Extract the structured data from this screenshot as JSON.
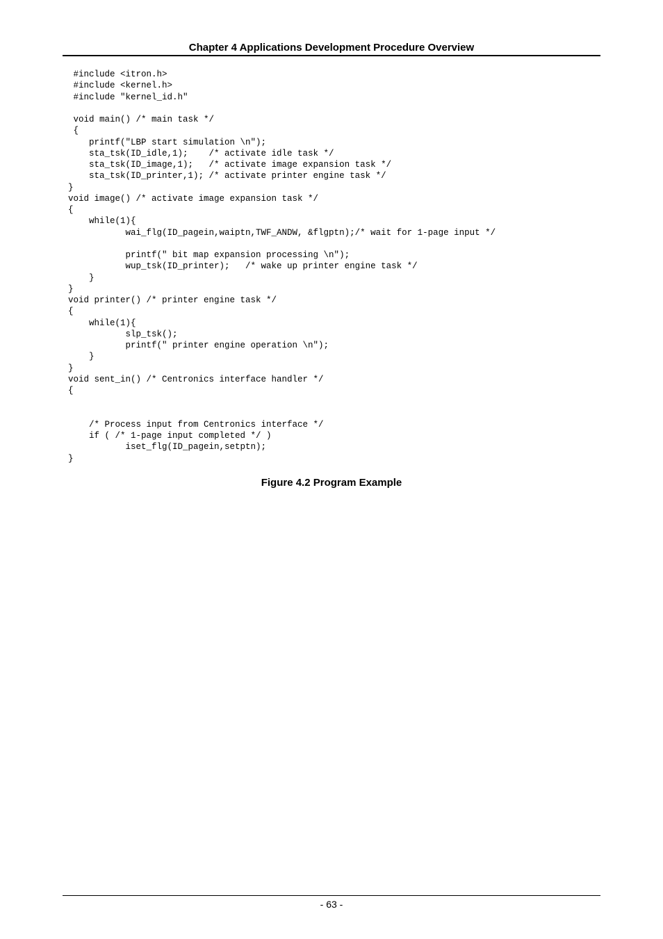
{
  "header": "Chapter 4 Applications Development Procedure Overview",
  "code": " #include <itron.h>\n #include <kernel.h>\n #include \"kernel_id.h\"\n\n void main() /* main task */\n {\n    printf(\"LBP start simulation \\n\");\n    sta_tsk(ID_idle,1);    /* activate idle task */\n    sta_tsk(ID_image,1);   /* activate image expansion task */\n    sta_tsk(ID_printer,1); /* activate printer engine task */\n}\nvoid image() /* activate image expansion task */\n{\n    while(1){\n           wai_flg(ID_pagein,waiptn,TWF_ANDW, &flgptn);/* wait for 1-page input */\n\n           printf(\" bit map expansion processing \\n\");\n           wup_tsk(ID_printer);   /* wake up printer engine task */\n    }\n}\nvoid printer() /* printer engine task */\n{\n    while(1){\n           slp_tsk();\n           printf(\" printer engine operation \\n\");\n    }\n}\nvoid sent_in() /* Centronics interface handler */\n{\n\n\n    /* Process input from Centronics interface */\n    if ( /* 1-page input completed */ )\n           iset_flg(ID_pagein,setptn);\n}",
  "figure_caption": "Figure 4.2 Program Example",
  "page_number": "- 63 -"
}
